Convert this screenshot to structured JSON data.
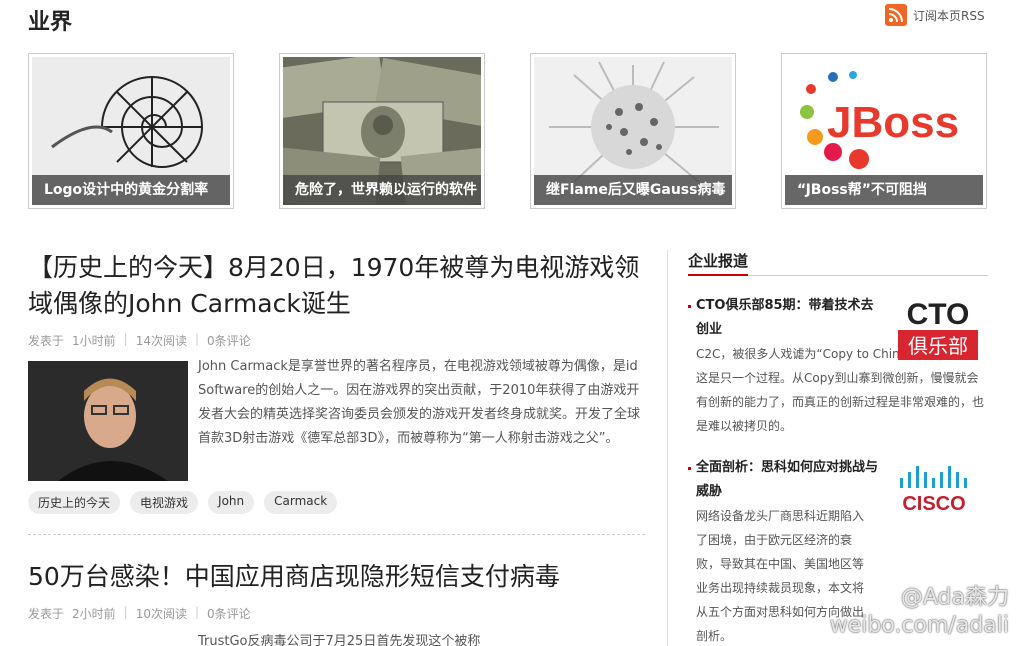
{
  "header": {
    "title": "业界",
    "rss_label": "订阅本页RSS"
  },
  "featured": [
    {
      "caption": "Logo设计中的黄金分割率",
      "image": "nautilus-shell"
    },
    {
      "caption": "危险了，世界赖以运行的软件",
      "image": "dollar-bills"
    },
    {
      "caption": "继Flame后又曝Gauss病毒",
      "image": "virus-model"
    },
    {
      "caption": "“JBoss帮”不可阻挡",
      "image": "jboss-logo",
      "logo_text": "JBoss"
    }
  ],
  "articles": [
    {
      "title": "【历史上的今天】8月20日，1970年被尊为电视游戏领域偶像的John Carmack诞生",
      "meta": {
        "posted_label": "发表于",
        "time": "1小时前",
        "reads": "14次阅读",
        "comments": "0条评论"
      },
      "summary": "John Carmack是享誉世界的著名程序员，在电视游戏领域被尊为偶像，是id Software的创始人之一。因在游戏界的突出贡献，于2010年获得了由游戏开发者大会的精英选择奖咨询委员会颁发的游戏开发者终身成就奖。开发了全球首款3D射击游戏《德军总部3D》，而被尊称为“第一人称射击游戏之父”。",
      "tags": [
        "历史上的今天",
        "电视游戏",
        "John",
        "Carmack"
      ]
    },
    {
      "title": "50万台感染！中国应用商店现隐形短信支付病毒",
      "meta": {
        "posted_label": "发表于",
        "time": "2小时前",
        "reads": "10次阅读",
        "comments": "0条评论"
      },
      "summary": "TrustGo反病毒公司于7月25日首先发现这个被称"
    }
  ],
  "sidebar": {
    "heading": "企业报道",
    "items": [
      {
        "title": "CTO俱乐部85期：带着技术去创业",
        "text": "C2C，被很多人戏谑为“Copy to China”，唐滔认为，这是只一个过程。从Copy到山寨到微创新，慢慢就会有创新的能力了，而真正的创新过程是非常艰难的，也是难以被拷贝的。",
        "logo_top": "CTO",
        "logo_bottom": "俱乐部"
      },
      {
        "title": "全面剖析：思科如何应对挑战与威胁",
        "text": "网络设备龙头厂商思科近期陷入了困境，由于欧元区经济的衰败，导致其在中国、美国地区等业务出现持续裁员现象，本文将从五个方面对思科如何方向做出剖析。",
        "logo_text": "CISCO"
      }
    ]
  },
  "watermark": {
    "line1": "@Ada森力",
    "line2": "weibo.com/adali"
  },
  "colors": {
    "accent": "#cc0000",
    "rss": "#f26522",
    "caption_bg": "#464646"
  }
}
